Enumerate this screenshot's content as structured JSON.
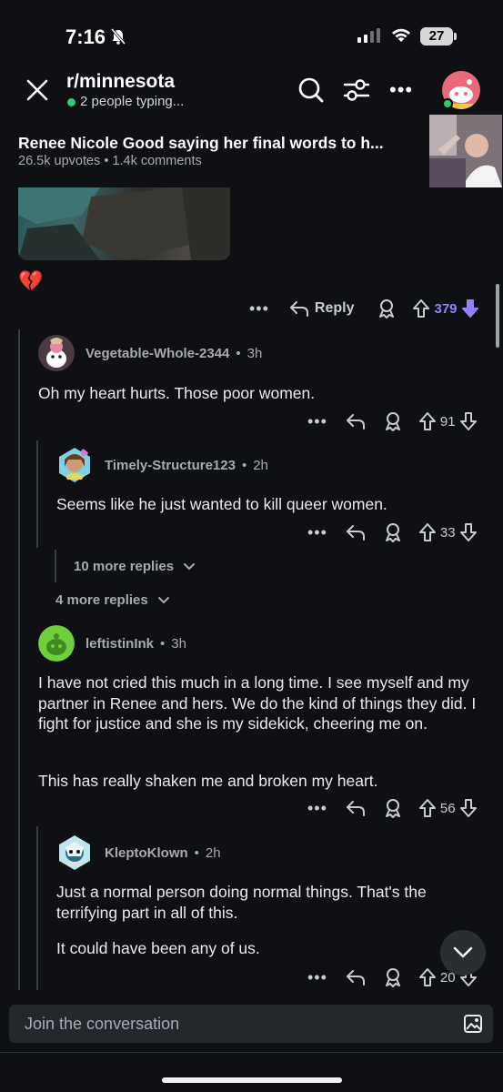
{
  "status": {
    "time": "7:16",
    "battery": "27"
  },
  "header": {
    "subreddit": "r/minnesota",
    "typing": "2 people typing..."
  },
  "post": {
    "title": "Renee Nicole Good saying her final words to h...",
    "meta": "26.5k upvotes • 1.4k comments",
    "emoji": "💔",
    "reply_label": "Reply",
    "votes": "379"
  },
  "comments": [
    {
      "user": "Vegetable-Whole-2344",
      "time": "3h",
      "text": "Oh my heart hurts. Those poor women.",
      "votes": "91"
    },
    {
      "user": "Timely-Structure123",
      "time": "2h",
      "text": "Seems like he just wanted to kill queer women.",
      "votes": "33"
    },
    {
      "user": "leftistinInk",
      "time": "3h",
      "paragraphs": [
        "I have not cried this much in a long time. I see myself and my partner in Renee and hers. We do the kind of things they did. I fight for justice and she is my sidekick, cheering me on.",
        "This has really shaken me and broken my heart."
      ],
      "votes": "56"
    },
    {
      "user": "KleptoKlown",
      "time": "2h",
      "paragraphs": [
        "Just a normal person doing normal things. That's the terrifying part in all of this.",
        "It could have been any of us."
      ],
      "votes": "20"
    }
  ],
  "more_replies": {
    "nested": "10 more replies",
    "level1": "4 more replies"
  },
  "composer": {
    "placeholder": "Join the conversation"
  },
  "separator": "•",
  "colors": {
    "background": "#0e1013",
    "accent_purple": "#8f83ff",
    "online_green": "#2ecc71"
  }
}
